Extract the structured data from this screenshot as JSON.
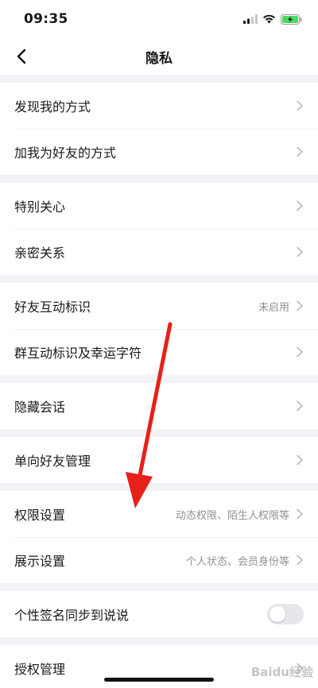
{
  "status_bar": {
    "time": "09:35"
  },
  "nav": {
    "title": "隐私"
  },
  "groups": [
    {
      "rows": [
        {
          "label": "发现我的方式",
          "value": ""
        },
        {
          "label": "加我为好友的方式",
          "value": ""
        }
      ]
    },
    {
      "rows": [
        {
          "label": "特别关心",
          "value": ""
        },
        {
          "label": "亲密关系",
          "value": ""
        }
      ]
    },
    {
      "rows": [
        {
          "label": "好友互动标识",
          "value": "未启用"
        },
        {
          "label": "群互动标识及幸运字符",
          "value": ""
        }
      ]
    },
    {
      "rows": [
        {
          "label": "隐藏会话",
          "value": ""
        }
      ]
    },
    {
      "rows": [
        {
          "label": "单向好友管理",
          "value": ""
        }
      ]
    },
    {
      "rows": [
        {
          "label": "权限设置",
          "value": "动态权限、陌生人权限等"
        },
        {
          "label": "展示设置",
          "value": "个人状态、会员身份等"
        }
      ]
    },
    {
      "rows": [
        {
          "label": "个性签名同步到说说",
          "toggle": false
        }
      ]
    },
    {
      "rows": [
        {
          "label": "授权管理",
          "value": ""
        }
      ]
    }
  ],
  "watermark": "Baidu经验",
  "colors": {
    "annotation_arrow": "#e8201a",
    "toggle_off": "#e6e7ec",
    "secondary_text": "#8f9196"
  }
}
